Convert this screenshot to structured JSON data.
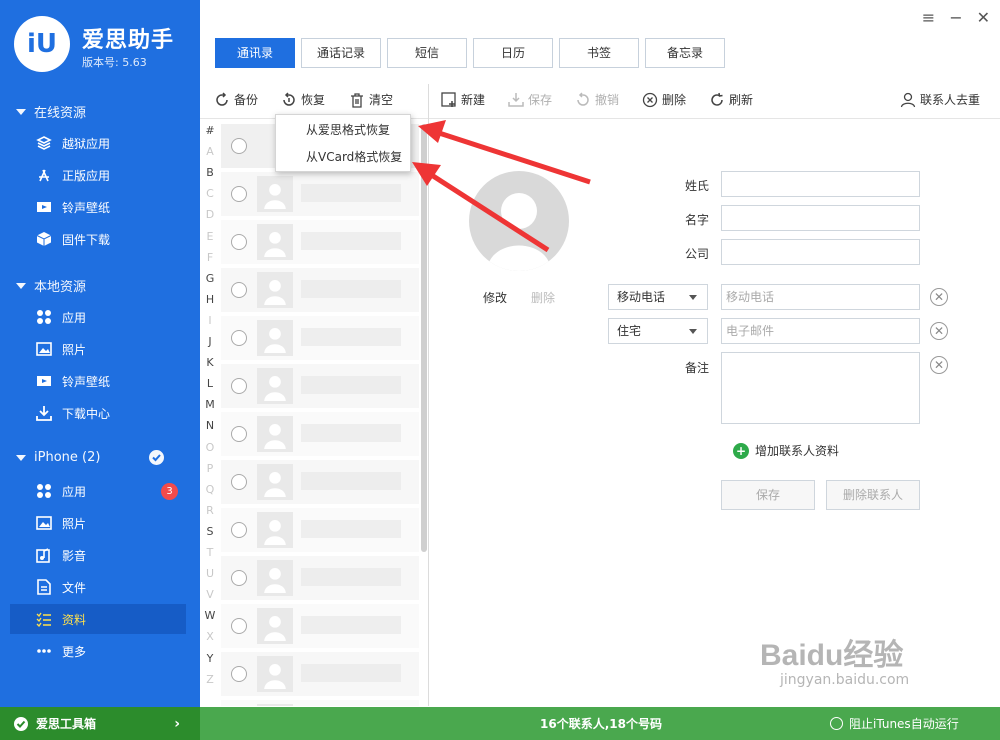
{
  "app": {
    "logo_text": "iU",
    "title": "爱思助手",
    "version": "版本号: 5.63"
  },
  "sidebar": {
    "sections": [
      {
        "label": "在线资源"
      },
      {
        "label": "本地资源"
      },
      {
        "label": "iPhone (2)"
      }
    ],
    "online": [
      {
        "label": "越狱应用",
        "icon": "layers-icon"
      },
      {
        "label": "正版应用",
        "icon": "appstore-icon"
      },
      {
        "label": "铃声壁纸",
        "icon": "film-icon"
      },
      {
        "label": "固件下载",
        "icon": "box-icon"
      }
    ],
    "local": [
      {
        "label": "应用",
        "icon": "grid-icon"
      },
      {
        "label": "照片",
        "icon": "photo-icon"
      },
      {
        "label": "铃声壁纸",
        "icon": "film-icon"
      },
      {
        "label": "下载中心",
        "icon": "download-icon"
      }
    ],
    "iphone": [
      {
        "label": "应用",
        "icon": "grid-icon",
        "badge": "3"
      },
      {
        "label": "照片",
        "icon": "photo-icon"
      },
      {
        "label": "影音",
        "icon": "music-icon"
      },
      {
        "label": "文件",
        "icon": "file-icon"
      },
      {
        "label": "资料",
        "icon": "list-icon",
        "active": true
      },
      {
        "label": "更多",
        "icon": "more-icon"
      }
    ],
    "toolbox": "爱思工具箱"
  },
  "tabs": [
    "通讯录",
    "通话记录",
    "短信",
    "日历",
    "书签",
    "备忘录"
  ],
  "toolbar_left": [
    "备份",
    "恢复",
    "清空"
  ],
  "toolbar_right": {
    "new": "新建",
    "save": "保存",
    "undo": "撤销",
    "delete": "删除",
    "refresh": "刷新",
    "dedupe": "联系人去重"
  },
  "restore_menu": [
    "从爱思格式恢复",
    "从VCard格式恢复"
  ],
  "letters": [
    "#",
    "A",
    "B",
    "C",
    "D",
    "E",
    "F",
    "G",
    "H",
    "I",
    "J",
    "K",
    "L",
    "M",
    "N",
    "O",
    "P",
    "Q",
    "R",
    "S",
    "T",
    "U",
    "V",
    "W",
    "X",
    "Y",
    "Z"
  ],
  "letters_active": [
    "#",
    "B",
    "G",
    "H",
    "J",
    "K",
    "L",
    "M",
    "N",
    "S",
    "W",
    "Y"
  ],
  "detail": {
    "avatar_edit": "修改",
    "avatar_delete": "删除",
    "fields": {
      "surname": "姓氏",
      "given": "名字",
      "company": "公司"
    },
    "phone_type": "移动电话",
    "phone_placeholder": "移动电话",
    "email_type": "住宅",
    "email_placeholder": "电子邮件",
    "note_label": "备注",
    "add_more": "增加联系人资料",
    "save_btn": "保存",
    "delete_btn": "删除联系人"
  },
  "status": {
    "count": "16个联系人,18个号码",
    "itunes": "阻止iTunes自动运行"
  },
  "watermark": {
    "brand": "Baidu经验",
    "url": "jingyan.baidu.com"
  },
  "colors": {
    "sidebar": "#1f6fe0",
    "active_tab": "#1f6fe0",
    "status_bar": "#4aa84e",
    "arrow": "#ee3535"
  }
}
